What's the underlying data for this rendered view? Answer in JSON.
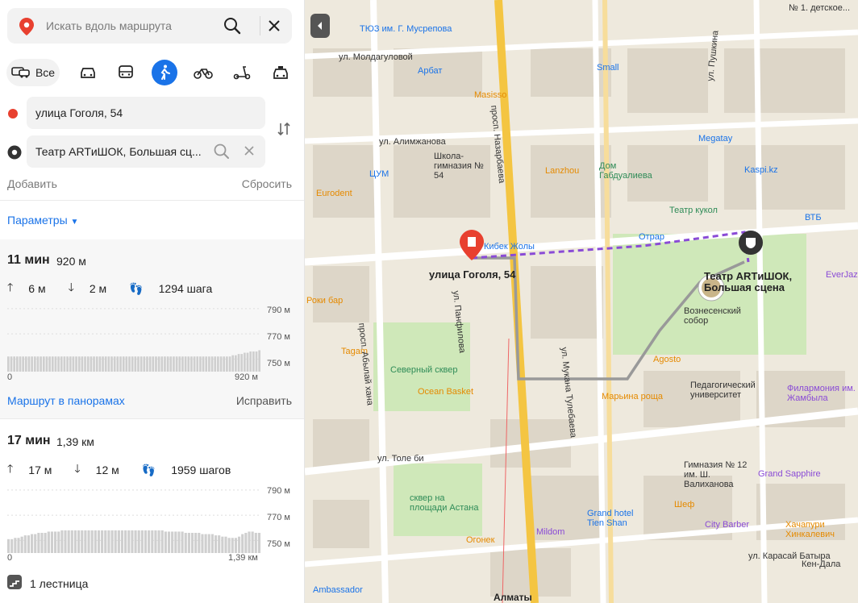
{
  "search": {
    "placeholder": "Искать вдоль маршрута"
  },
  "modes": {
    "all_label": "Все",
    "icons": [
      "car-icon",
      "bus-icon",
      "pedestrian-icon",
      "bicycle-icon",
      "scooter-icon",
      "taxi-icon"
    ],
    "active": "pedestrian-icon"
  },
  "points": {
    "from": "улица Гоголя, 54",
    "to": "Театр ARTиШОК, Большая сц..."
  },
  "links": {
    "add": "Добавить",
    "reset": "Сбросить"
  },
  "params_label": "Параметры",
  "routes": [
    {
      "time": "11 мин",
      "distance": "920 м",
      "up": "6 м",
      "down": "2 м",
      "steps": "1294 шага",
      "elev_ticks": [
        "790 м",
        "770 м",
        "750 м"
      ],
      "x_start": "0",
      "x_end": "920 м",
      "elevation": [
        752,
        752,
        752,
        752,
        752,
        752,
        752,
        752,
        752,
        752,
        752,
        752,
        752,
        752,
        752,
        752,
        752,
        752,
        752,
        752,
        752,
        752,
        752,
        752,
        752,
        752,
        752,
        752,
        752,
        752,
        752,
        752,
        752,
        752,
        752,
        752,
        752,
        752,
        752,
        752,
        752,
        752,
        752,
        752,
        752,
        752,
        752,
        752,
        752,
        752,
        752,
        752,
        752,
        752,
        752,
        752,
        752,
        752,
        752,
        752,
        752,
        752,
        752,
        752,
        752,
        752,
        752,
        752,
        752,
        752,
        752,
        752,
        752,
        752,
        752,
        752,
        753,
        753,
        754,
        754,
        755,
        755,
        756,
        756,
        756,
        757
      ],
      "panorama": "Маршрут в панорамах",
      "fix": "Исправить"
    },
    {
      "time": "17 мин",
      "distance": "1,39 км",
      "up": "17 м",
      "down": "12 м",
      "steps": "1959 шагов",
      "elev_ticks": [
        "790 м",
        "770 м",
        "750 м"
      ],
      "x_start": "0",
      "x_end": "1,39 км",
      "elevation": [
        751,
        751,
        752,
        752,
        753,
        754,
        754,
        755,
        755,
        756,
        756,
        756,
        757,
        757,
        757,
        757,
        758,
        758,
        758,
        758,
        758,
        758,
        758,
        758,
        758,
        758,
        758,
        758,
        758,
        758,
        758,
        758,
        758,
        758,
        758,
        758,
        758,
        758,
        758,
        758,
        758,
        758,
        758,
        758,
        758,
        758,
        758,
        757,
        757,
        757,
        757,
        757,
        757,
        756,
        756,
        756,
        756,
        756,
        755,
        755,
        755,
        755,
        754,
        754,
        753,
        753,
        752,
        752,
        752,
        753,
        755,
        756,
        757,
        757,
        756,
        756
      ],
      "stairs": "1 лестница"
    }
  ],
  "colors": {
    "accent": "#1a73e8",
    "route": "#8a4bd6",
    "start": "#e8402f"
  },
  "map": {
    "labels": [
      "ТЮЗ им. Г. Мусрепова",
      "ул. Молдагуловой",
      "Арбат",
      "Masisso",
      "ул. Алимжанова",
      "ЦУМ",
      "Школа-гимназия № 54",
      "Eurodent",
      "Lanzhou",
      "Дом Габдуалиева",
      "Кибек Жолы",
      "Театр кукол",
      "Отрар",
      "улица Гоголя, 54",
      "Театр ARTиШОК, Большая сцена",
      "Вознесенский собор",
      "Роки бар",
      "Tagam",
      "Agosto",
      "Северный сквер",
      "Ocean Basket",
      "Марьина роща",
      "Педагогический университет",
      "ул. Толе би",
      "сквер на площади Астана",
      "Гимназия № 12 им. Ш. Валиханова",
      "Grand Sapphire",
      "Филармония им. Жамбыла",
      "Grand hotel Tien Shan",
      "Шеф",
      "City Barber",
      "Хачапури Хинкалевич",
      "Огонек",
      "Mildom",
      "Алматы",
      "ул. Карасай Батыра",
      "Кен-Дала",
      "Ambassador",
      "просп. Назарбаева",
      "просп. Абылай хана",
      "ул. Панфилова",
      "ул. Мукана Тулебаева",
      "Megatay",
      "Small",
      "Kaspi.kz",
      "ВТБ",
      "EverJazz",
      "№ 1. детское...",
      "ул. Пушкина"
    ]
  }
}
